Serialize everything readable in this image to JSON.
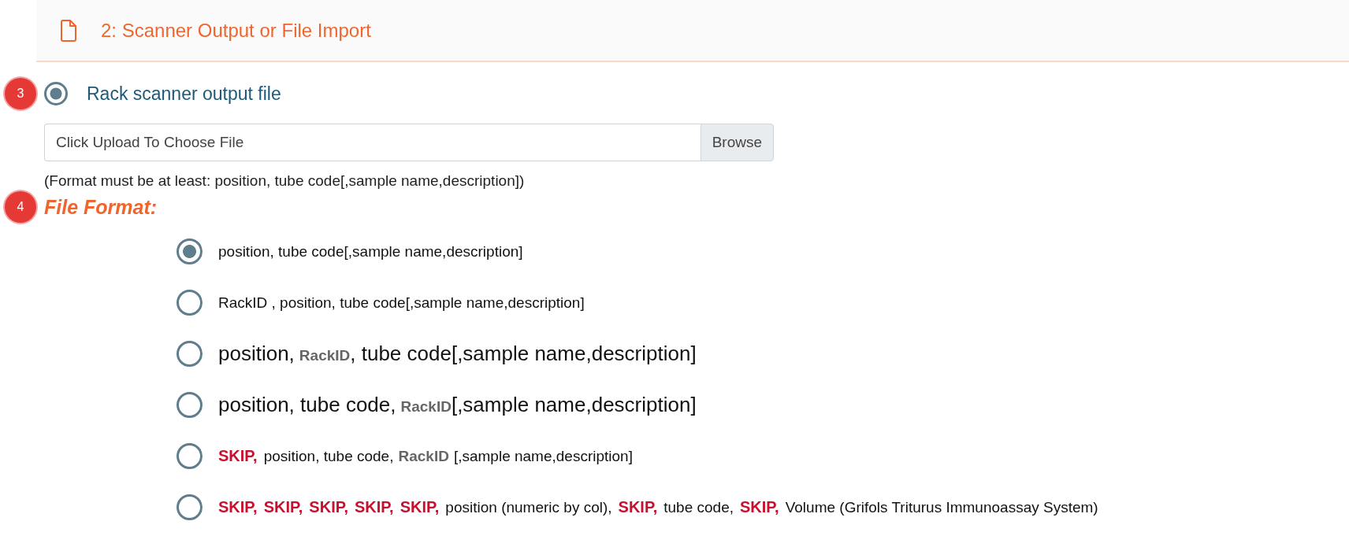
{
  "section_header": {
    "title": "2: Scanner Output or File Import"
  },
  "source_option": {
    "marker": "3",
    "label": "Rack scanner output file",
    "selected": true
  },
  "file_input": {
    "placeholder": "Click Upload To Choose File",
    "button": "Browse"
  },
  "format_hint": "(Format must be at least: position, tube code[,sample name,description])",
  "file_format": {
    "marker": "4",
    "label": "File Format:",
    "options": [
      {
        "kind": "compact",
        "selected": true,
        "segments": [
          {
            "kind": "text",
            "text": "position, tube code[,sample name,description]"
          }
        ]
      },
      {
        "kind": "compact",
        "selected": false,
        "segments": [
          {
            "kind": "text",
            "text": "RackID , position, tube code[,sample name,description]"
          }
        ]
      },
      {
        "kind": "large",
        "selected": false,
        "segments": [
          {
            "kind": "text",
            "text": "position,"
          },
          {
            "kind": "field",
            "text": "RackID"
          },
          {
            "kind": "text",
            "text": ", tube code[,sample name,description]"
          }
        ]
      },
      {
        "kind": "large",
        "selected": false,
        "segments": [
          {
            "kind": "text",
            "text": "position, tube code,"
          },
          {
            "kind": "field",
            "text": "RackID"
          },
          {
            "kind": "text",
            "text": "[,sample name,description]"
          }
        ]
      },
      {
        "kind": "compact",
        "selected": false,
        "segments": [
          {
            "kind": "skip",
            "text": "SKIP,"
          },
          {
            "kind": "text",
            "text": "position, tube code,"
          },
          {
            "kind": "field",
            "text": "RackID"
          },
          {
            "kind": "text",
            "text": "[,sample name,description]"
          }
        ]
      },
      {
        "kind": "compact",
        "selected": false,
        "segments": [
          {
            "kind": "skip",
            "text": "SKIP,"
          },
          {
            "kind": "skip",
            "text": "SKIP,"
          },
          {
            "kind": "skip",
            "text": "SKIP,"
          },
          {
            "kind": "skip",
            "text": "SKIP,"
          },
          {
            "kind": "skip",
            "text": "SKIP,"
          },
          {
            "kind": "text",
            "text": "position (numeric by col),"
          },
          {
            "kind": "skip",
            "text": "SKIP,"
          },
          {
            "kind": "text",
            "text": "tube code,"
          },
          {
            "kind": "skip",
            "text": "SKIP,"
          },
          {
            "kind": "text",
            "text": "Volume (Grifols Triturus Immunoassay System)"
          }
        ]
      }
    ]
  }
}
